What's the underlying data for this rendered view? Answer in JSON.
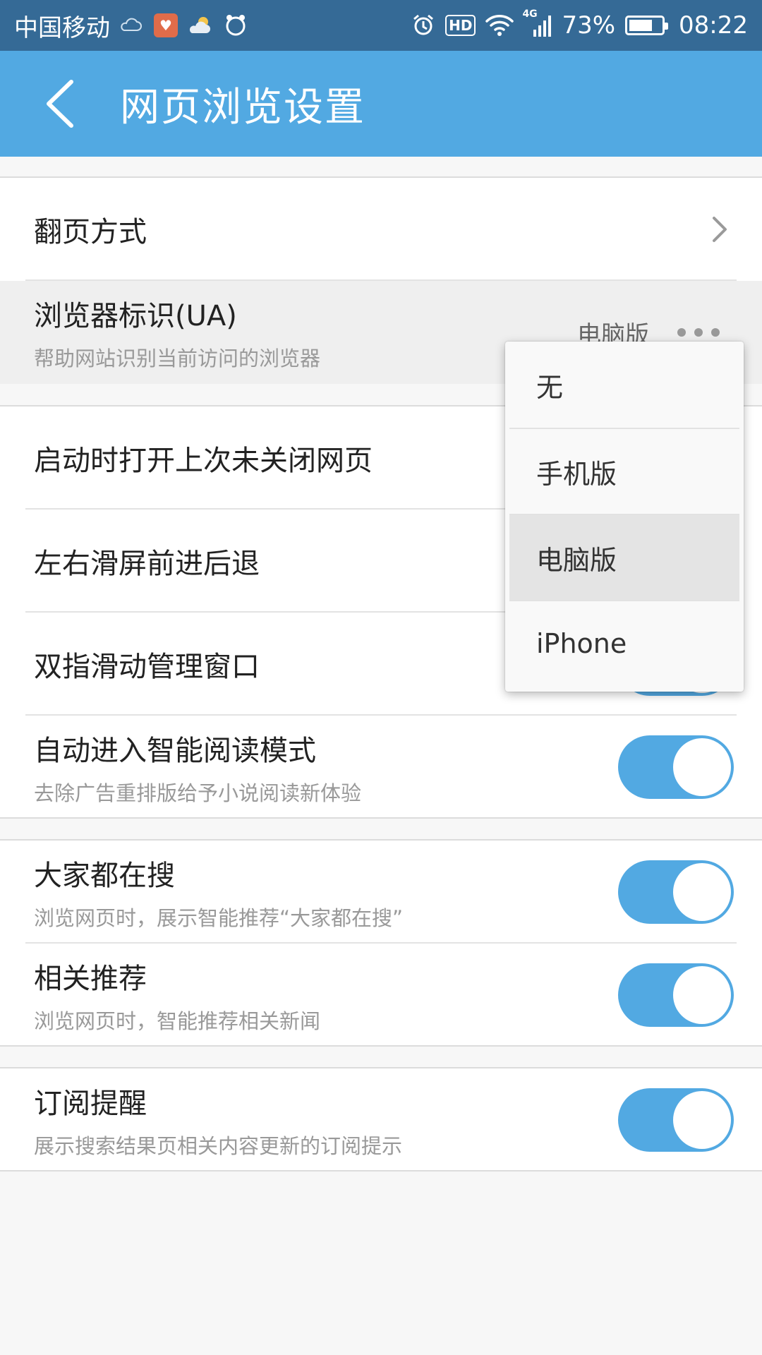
{
  "status_bar": {
    "carrier": "中国移动",
    "network": "4G",
    "battery_percent": "73%",
    "battery_level": 0.73,
    "time": "08:22",
    "hd_label": "HD",
    "icons": [
      "cloud-moon-icon",
      "health-app-icon",
      "weather-icon",
      "rocket-icon",
      "alarm-icon",
      "hd-icon",
      "wifi-icon",
      "signal-icon",
      "battery-icon"
    ]
  },
  "header": {
    "title": "网页浏览设置"
  },
  "settings": {
    "page_turn": {
      "title": "翻页方式"
    },
    "ua": {
      "title": "浏览器标识(UA)",
      "subtitle": "帮助网站识别当前访问的浏览器",
      "value": "电脑版"
    },
    "restore_tabs": {
      "title": "启动时打开上次未关闭网页"
    },
    "swipe_nav": {
      "title": "左右滑屏前进后退"
    },
    "two_finger": {
      "title": "双指滑动管理窗口"
    },
    "smart_reading": {
      "title": "自动进入智能阅读模式",
      "subtitle": "去除广告重排版给予小说阅读新体验",
      "enabled": true
    },
    "trending": {
      "title": "大家都在搜",
      "subtitle": "浏览网页时，展示智能推荐“大家都在搜”",
      "enabled": true
    },
    "related": {
      "title": "相关推荐",
      "subtitle": "浏览网页时，智能推荐相关新闻",
      "enabled": true
    },
    "subscribe": {
      "title": "订阅提醒",
      "subtitle": "展示搜索结果页相关内容更新的订阅提示",
      "enabled": true
    }
  },
  "ua_menu": {
    "options": [
      "无",
      "手机版",
      "电脑版",
      "iPhone"
    ],
    "selected": "电脑版"
  },
  "colors": {
    "accent": "#52a9e2",
    "status_bar": "#356a96",
    "background": "#f7f7f7"
  }
}
